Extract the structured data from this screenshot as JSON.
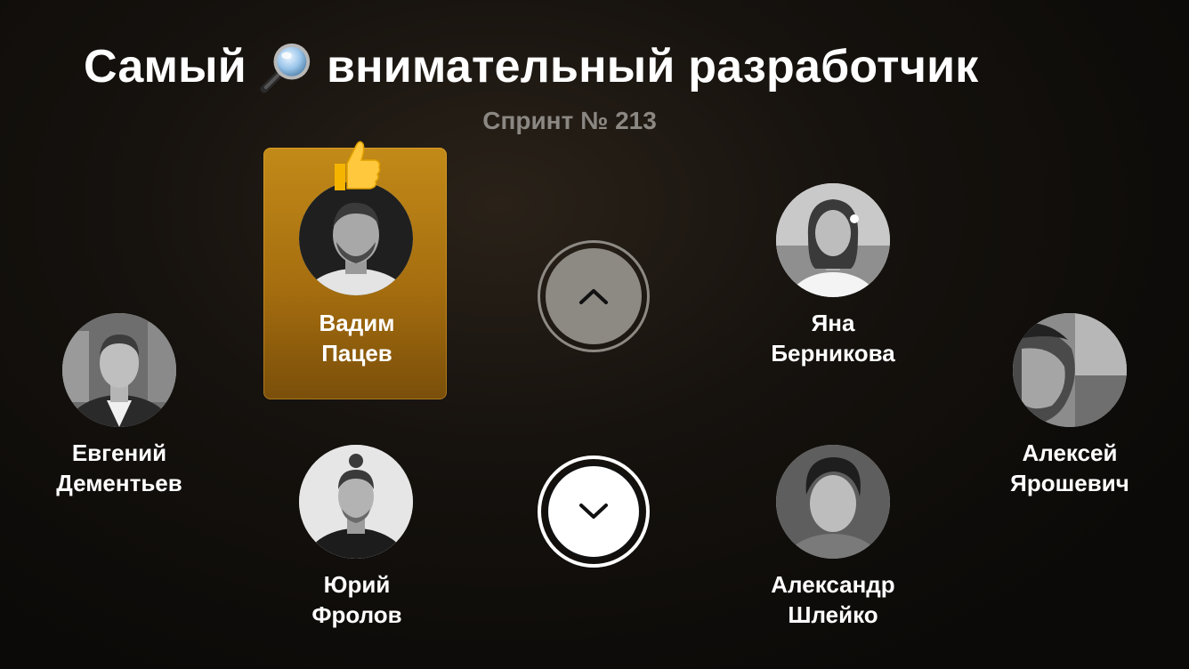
{
  "header": {
    "title_before": "Самый",
    "title_icon": "magnifier-icon",
    "title_after": "внимательный разработчик",
    "subtitle": "Спринт № 213"
  },
  "people": [
    {
      "first_name": "Вадим",
      "last_name": "Пацев",
      "selected": true,
      "badge_icon": "thumbs-up-icon"
    },
    {
      "first_name": "Яна",
      "last_name": "Берникова",
      "selected": false
    },
    {
      "first_name": "Евгений",
      "last_name": "Дементьев",
      "selected": false
    },
    {
      "first_name": "Алексей",
      "last_name": "Ярошевич",
      "selected": false
    },
    {
      "first_name": "Юрий",
      "last_name": "Фролов",
      "selected": false
    },
    {
      "first_name": "Александр",
      "last_name": "Шлейко",
      "selected": false
    }
  ],
  "navigation": {
    "up_icon": "chevron-up-icon",
    "down_icon": "chevron-down-icon",
    "focused": "down"
  },
  "colors": {
    "highlight": "#b47c12",
    "subtitle": "#8b8782",
    "nav_inactive": "#8d8983",
    "nav_active": "#ffffff"
  }
}
